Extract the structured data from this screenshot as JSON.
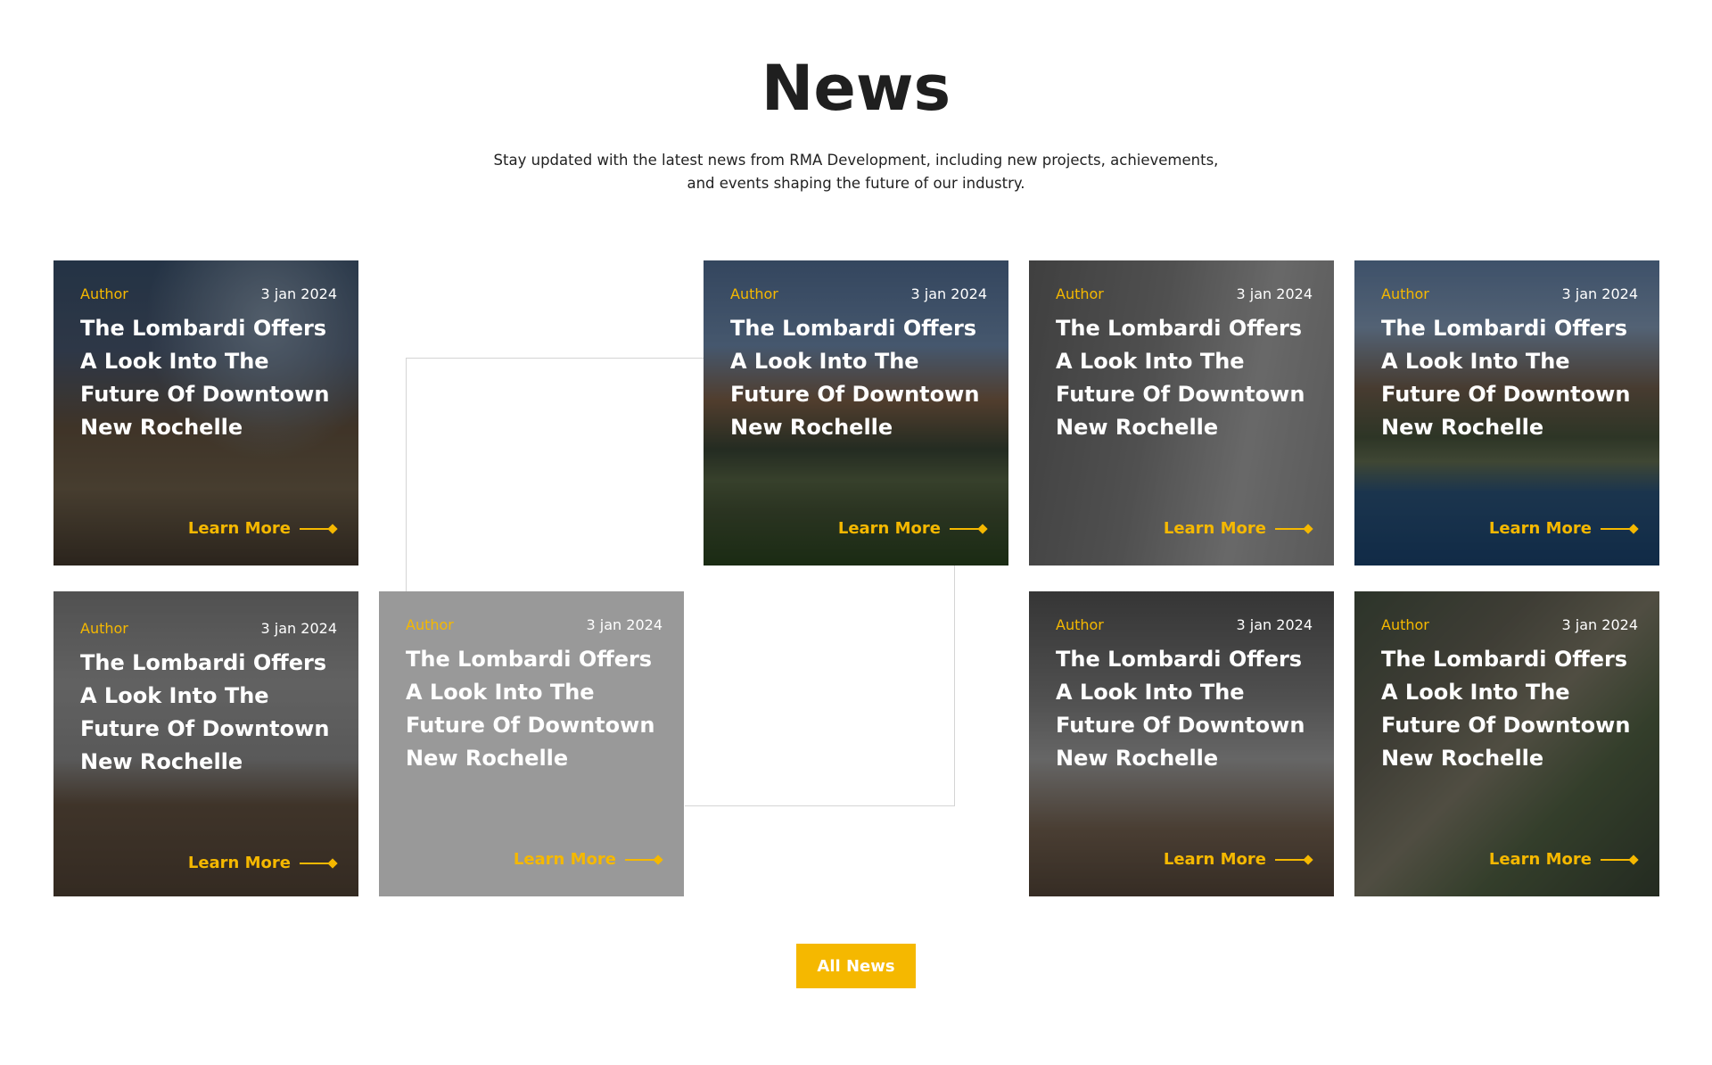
{
  "header": {
    "title": "News",
    "subtitle": "Stay updated with the latest news from RMA Development, including new projects, achievements, and events shaping the future of our industry."
  },
  "cards": [
    {
      "author": "Author",
      "date": "3 jan 2024",
      "headline": "The Lombardi Offers A Look Into The Future Of Downtown New Rochelle",
      "cta": "Learn More",
      "image": "construction-site"
    },
    {
      "author": "Author",
      "date": "3 jan 2024",
      "headline": "The Lombardi Offers A Look Into The Future Of Downtown New Rochelle",
      "cta": "Learn More",
      "image": "building-exterior"
    },
    {
      "author": "Author",
      "date": "3 jan 2024",
      "headline": "The Lombardi Offers A Look Into The Future Of Downtown New Rochelle",
      "cta": "Learn More",
      "image": "inspection-clipboard"
    },
    {
      "author": "Author",
      "date": "3 jan 2024",
      "headline": "The Lombardi Offers A Look Into The Future Of Downtown New Rochelle",
      "cta": "Learn More",
      "image": "waterfront-building"
    },
    {
      "author": "Author",
      "date": "3 jan 2024",
      "headline": "The Lombardi Offers A Look Into The Future Of Downtown New Rochelle",
      "cta": "Learn More",
      "image": "living-room"
    },
    {
      "author": "Author",
      "date": "3 jan 2024",
      "headline": "The Lombardi Offers A Look Into The Future Of Downtown New Rochelle",
      "cta": "Learn More",
      "image": "none"
    },
    {
      "author": "Author",
      "date": "3 jan 2024",
      "headline": "The Lombardi Offers A Look Into The Future Of Downtown New Rochelle",
      "cta": "Learn More",
      "image": "kitchen"
    },
    {
      "author": "Author",
      "date": "3 jan 2024",
      "headline": "The Lombardi Offers A Look Into The Future Of Downtown New Rochelle",
      "cta": "Learn More",
      "image": "aerial-construction"
    }
  ],
  "footer": {
    "all_news_label": "All News"
  },
  "colors": {
    "accent": "#f5b800",
    "text": "#1f1f1f",
    "placeholder_card": "#999999"
  }
}
